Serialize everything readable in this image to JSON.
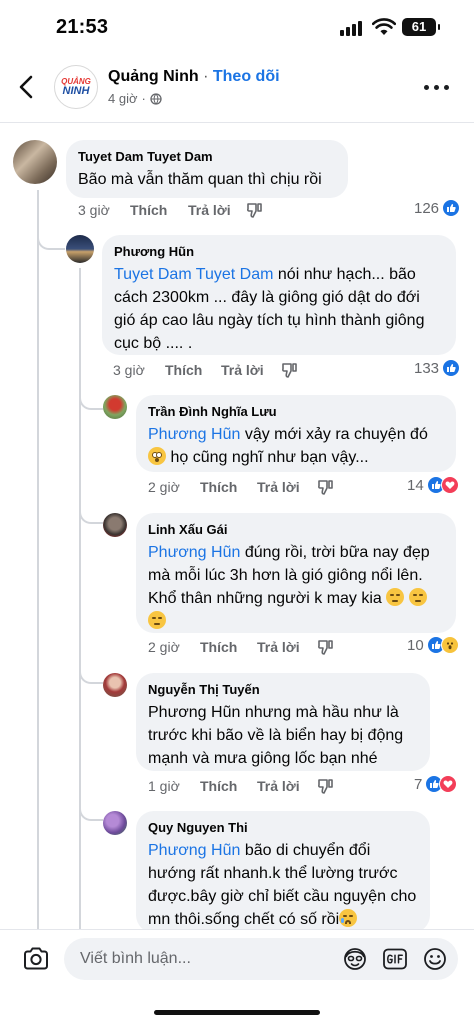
{
  "status_bar": {
    "time": "21:53",
    "battery": "61"
  },
  "header": {
    "page_name": "Quảng Ninh",
    "separator": " · ",
    "follow_label": "Theo dõi",
    "post_time": "4 giờ",
    "logo_top": "QUẢNG",
    "logo_bottom": "NINH"
  },
  "actions": {
    "like": "Thích",
    "reply": "Trả lời"
  },
  "comments": [
    {
      "author": "Tuyet Dam Tuyet Dam",
      "text": "Bão mà vẫn thăm quan thì chịu rồi",
      "time": "3 giờ",
      "reactions": "126"
    },
    {
      "author": "Phương Hũn",
      "mention": "Tuyet Dam Tuyet Dam",
      "text": "  nói như hạch... bão cách 2300km ... đây là giông gió dật do đới gió áp cao lâu ngày tích tụ hình thành giông cục bộ .... .",
      "time": "3 giờ",
      "reactions": "133"
    },
    {
      "author": "Trần Đình Nghĩa Lưu",
      "mention": "Phương Hũn",
      "text_a": " vậy mới xảy ra chuyện đó",
      "text_b": " họ cũng nghĩ như bạn vậy...",
      "time": "2 giờ",
      "reactions": "14"
    },
    {
      "author": "Linh Xấu Gái",
      "mention": "Phương Hũn",
      "text": " đúng rồi, trời bữa nay đẹp mà mỗi lúc 3h hơn là gió giông nổi lên. Khổ thân những người k may kia ",
      "time": "2 giờ",
      "reactions": "10"
    },
    {
      "author": "Nguyễn Thị Tuyến",
      "text": "Phương Hũn nhưng mà hầu như là trước khi bão về là biển hay bị động mạnh và mưa giông lốc bạn nhé",
      "time": "1 giờ",
      "reactions": "7"
    },
    {
      "author": "Quy Nguyen Thi",
      "mention": "Phương Hũn",
      "text": " bão di chuyển đổi hướng rất nhanh.k thể lường trước được.bây giờ chỉ biết cầu nguyện cho mn thôi.sống chết có số rồi"
    }
  ],
  "composer": {
    "placeholder": "Viết bình luận..."
  },
  "colors": {
    "accent": "#1b74e4",
    "bubble": "#f0f2f5",
    "muted": "#65676b",
    "love": "#f33e58"
  }
}
